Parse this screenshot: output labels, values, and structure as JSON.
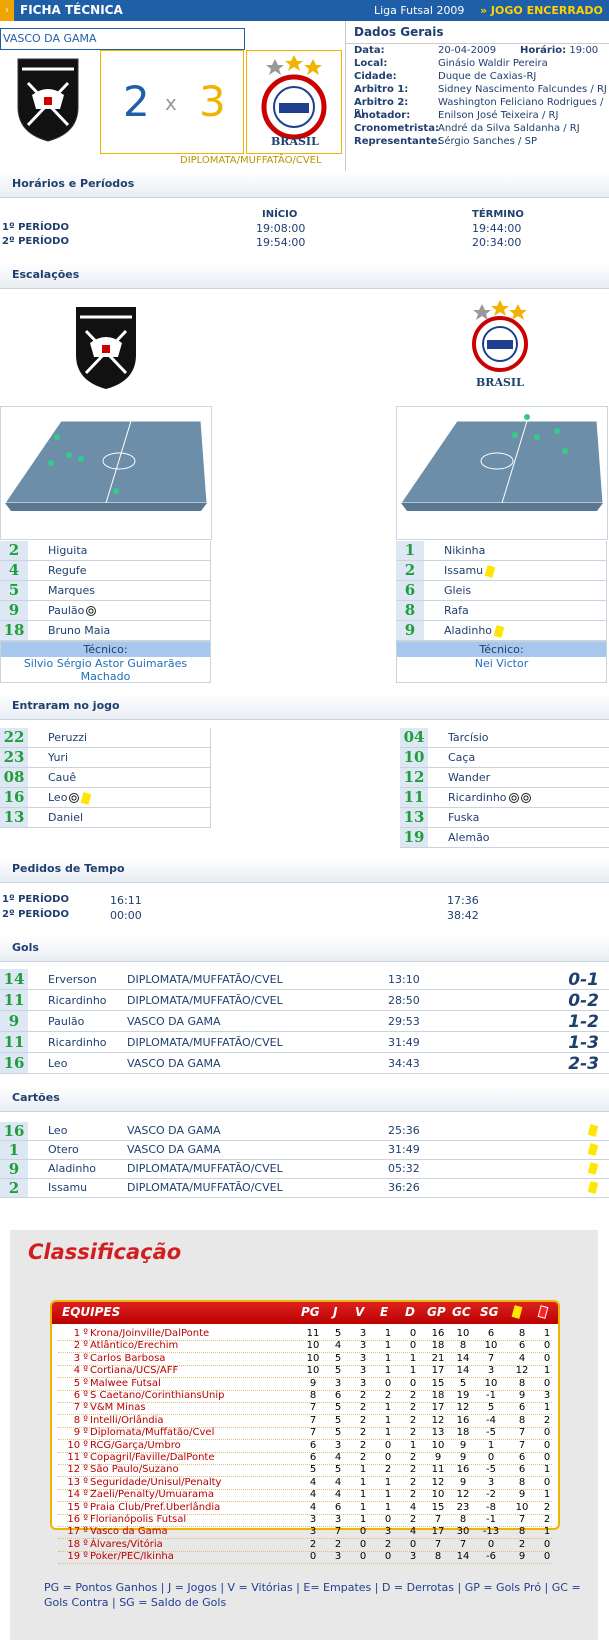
{
  "header": {
    "title": "FICHA TÉCNICA",
    "league": "Liga Futsal 2009",
    "status": "» JOGO ENCERRADO"
  },
  "match": {
    "home_name": "VASCO DA GAMA",
    "away_name": "DIPLOMATA/MUFFATÃO/CVEL",
    "home_score": "2",
    "separator": "x",
    "away_score": "3",
    "away_logo_text": "BRASIL"
  },
  "dados": {
    "title": "Dados Gerais",
    "rows": [
      {
        "label": "Data:",
        "value": "20-04-2009"
      },
      {
        "label": "Local:",
        "value": "Ginásio Waldir Pereira"
      },
      {
        "label": "Cidade:",
        "value": "Duque de Caxias-RJ"
      },
      {
        "label": "Arbitro 1:",
        "value": "Sidney Nascimento Falcundes / RJ"
      },
      {
        "label": "Arbitro 2:",
        "value": "Washington Feliciano Rodrigues / RJ"
      },
      {
        "label": "Anotador:",
        "value": "Enilson José Teixeira / RJ"
      },
      {
        "label": "Cronometrista:",
        "value": "André da Silva Saldanha / RJ"
      },
      {
        "label": "Representante:",
        "value": "Sérgio Sanches / SP"
      }
    ],
    "horario_label": "Horário:",
    "horario_value": "19:00"
  },
  "horarios": {
    "title": "Horários e Períodos",
    "inicio": "INÍCIO",
    "termino": "TÉRMINO",
    "rows": [
      {
        "label": "1º PERÍODO",
        "start": "19:08:00",
        "end": "19:44:00"
      },
      {
        "label": "2º PERÍODO",
        "start": "19:54:00",
        "end": "20:34:00"
      }
    ]
  },
  "escalacoes": {
    "title": "Escalações",
    "home": [
      {
        "num": "2",
        "name": "Higuita"
      },
      {
        "num": "4",
        "name": "Regufe"
      },
      {
        "num": "5",
        "name": "Marques"
      },
      {
        "num": "9",
        "name": "Paulão"
      },
      {
        "num": "18",
        "name": "Bruno Maia"
      }
    ],
    "away": [
      {
        "num": "1",
        "name": "Nikinha"
      },
      {
        "num": "2",
        "name": "Issamu"
      },
      {
        "num": "6",
        "name": "Gleis"
      },
      {
        "num": "8",
        "name": "Rafa"
      },
      {
        "num": "9",
        "name": "Aladinho"
      }
    ],
    "tecnico_label": "Técnico:",
    "home_tecnico": "Silvio Sérgio Astor Guimarães Machado",
    "away_tecnico": "Nei Victor"
  },
  "entraram": {
    "title": "Entraram no jogo",
    "home": [
      {
        "num": "22",
        "name": "Peruzzi"
      },
      {
        "num": "23",
        "name": "Yuri"
      },
      {
        "num": "08",
        "name": "Cauê"
      },
      {
        "num": "16",
        "name": "Leo"
      },
      {
        "num": "13",
        "name": "Daniel"
      }
    ],
    "away": [
      {
        "num": "04",
        "name": "Tarcísio"
      },
      {
        "num": "10",
        "name": "Caça"
      },
      {
        "num": "12",
        "name": "Wander"
      },
      {
        "num": "11",
        "name": "Ricardinho"
      },
      {
        "num": "13",
        "name": "Fuska"
      },
      {
        "num": "19",
        "name": "Alemão"
      }
    ]
  },
  "pedidos": {
    "title": "Pedidos de Tempo",
    "rows": [
      {
        "label": "1º PERÍODO",
        "home": "16:11",
        "away": "17:36"
      },
      {
        "label": "2º PERÍODO",
        "home": "00:00",
        "away": "38:42"
      }
    ]
  },
  "gols": {
    "title": "Gols",
    "rows": [
      {
        "num": "14",
        "player": "Erverson",
        "team": "DIPLOMATA/MUFFATÃO/CVEL",
        "time": "13:10",
        "score": "0-1"
      },
      {
        "num": "11",
        "player": "Ricardinho",
        "team": "DIPLOMATA/MUFFATÃO/CVEL",
        "time": "28:50",
        "score": "0-2"
      },
      {
        "num": "9",
        "player": "Paulão",
        "team": "VASCO DA GAMA",
        "time": "29:53",
        "score": "1-2"
      },
      {
        "num": "11",
        "player": "Ricardinho",
        "team": "DIPLOMATA/MUFFATÃO/CVEL",
        "time": "31:49",
        "score": "1-3"
      },
      {
        "num": "16",
        "player": "Leo",
        "team": "VASCO DA GAMA",
        "time": "34:43",
        "score": "2-3"
      }
    ]
  },
  "cartoes": {
    "title": "Cartões",
    "rows": [
      {
        "num": "16",
        "player": "Leo",
        "team": "VASCO DA GAMA",
        "time": "25:36"
      },
      {
        "num": "1",
        "player": "Otero",
        "team": "VASCO DA GAMA",
        "time": "31:49"
      },
      {
        "num": "9",
        "player": "Aladinho",
        "team": "DIPLOMATA/MUFFATÃO/CVEL",
        "time": "05:32"
      },
      {
        "num": "2",
        "player": "Issamu",
        "team": "DIPLOMATA/MUFFATÃO/CVEL",
        "time": "36:26"
      }
    ]
  },
  "classificacao": {
    "title": "Classificação",
    "headers": [
      "EQUIPES",
      "PG",
      "J",
      "V",
      "E",
      "D",
      "GP",
      "GC",
      "SG"
    ],
    "rows": [
      {
        "pos": "1 º",
        "team": "Krona/Joinville/DalPonte",
        "v": [
          "11",
          "5",
          "3",
          "1",
          "0",
          "16",
          "10",
          "6",
          "8",
          "1"
        ]
      },
      {
        "pos": "2 º",
        "team": "Atlântico/Erechim",
        "v": [
          "10",
          "4",
          "3",
          "1",
          "0",
          "18",
          "8",
          "10",
          "6",
          "0"
        ]
      },
      {
        "pos": "3 º",
        "team": "Carlos Barbosa",
        "v": [
          "10",
          "5",
          "3",
          "1",
          "1",
          "21",
          "14",
          "7",
          "4",
          "0"
        ]
      },
      {
        "pos": "4 º",
        "team": "Cortiana/UCS/AFF",
        "v": [
          "10",
          "5",
          "3",
          "1",
          "1",
          "17",
          "14",
          "3",
          "12",
          "1"
        ]
      },
      {
        "pos": "5 º",
        "team": "Malwee Futsal",
        "v": [
          "9",
          "3",
          "3",
          "0",
          "0",
          "15",
          "5",
          "10",
          "8",
          "0"
        ]
      },
      {
        "pos": "6 º",
        "team": "S Caetano/CorinthiansUnip",
        "v": [
          "8",
          "6",
          "2",
          "2",
          "2",
          "18",
          "19",
          "-1",
          "9",
          "3"
        ]
      },
      {
        "pos": "7 º",
        "team": "V&M Minas",
        "v": [
          "7",
          "5",
          "2",
          "1",
          "2",
          "17",
          "12",
          "5",
          "6",
          "1"
        ]
      },
      {
        "pos": "8 º",
        "team": "Intelli/Orlândia",
        "v": [
          "7",
          "5",
          "2",
          "1",
          "2",
          "12",
          "16",
          "-4",
          "8",
          "2"
        ]
      },
      {
        "pos": "9 º",
        "team": "Diplomata/Muffatão/Cvel",
        "v": [
          "7",
          "5",
          "2",
          "1",
          "2",
          "13",
          "18",
          "-5",
          "7",
          "0"
        ]
      },
      {
        "pos": "10 º",
        "team": "RCG/Garça/Umbro",
        "v": [
          "6",
          "3",
          "2",
          "0",
          "1",
          "10",
          "9",
          "1",
          "7",
          "0"
        ]
      },
      {
        "pos": "11 º",
        "team": "Copagril/Faville/DalPonte",
        "v": [
          "6",
          "4",
          "2",
          "0",
          "2",
          "9",
          "9",
          "0",
          "6",
          "0"
        ]
      },
      {
        "pos": "12 º",
        "team": "São Paulo/Suzano",
        "v": [
          "5",
          "5",
          "1",
          "2",
          "2",
          "11",
          "16",
          "-5",
          "6",
          "1"
        ]
      },
      {
        "pos": "13 º",
        "team": "Seguridade/Unisul/Penalty",
        "v": [
          "4",
          "4",
          "1",
          "1",
          "2",
          "12",
          "9",
          "3",
          "8",
          "0"
        ]
      },
      {
        "pos": "14 º",
        "team": "Zaeli/Penalty/Umuarama",
        "v": [
          "4",
          "4",
          "1",
          "1",
          "2",
          "10",
          "12",
          "-2",
          "9",
          "1"
        ]
      },
      {
        "pos": "15 º",
        "team": "Praia Club/Pref.Uberlândia",
        "v": [
          "4",
          "6",
          "1",
          "1",
          "4",
          "15",
          "23",
          "-8",
          "10",
          "2"
        ]
      },
      {
        "pos": "16 º",
        "team": "Florianópolis Futsal",
        "v": [
          "3",
          "3",
          "1",
          "0",
          "2",
          "7",
          "8",
          "-1",
          "7",
          "2"
        ]
      },
      {
        "pos": "17 º",
        "team": "Vasco da Gama",
        "v": [
          "3",
          "7",
          "0",
          "3",
          "4",
          "17",
          "30",
          "-13",
          "8",
          "1"
        ]
      },
      {
        "pos": "18 º",
        "team": "Álvares/Vitória",
        "v": [
          "2",
          "2",
          "0",
          "2",
          "0",
          "7",
          "7",
          "0",
          "2",
          "0"
        ]
      },
      {
        "pos": "19 º",
        "team": "Poker/PEC/Ikinha",
        "v": [
          "0",
          "3",
          "0",
          "0",
          "3",
          "8",
          "14",
          "-6",
          "9",
          "0"
        ]
      }
    ],
    "legend": "PG = Pontos Ganhos | J = Jogos | V = Vitórias | E= Empates | D = Derrotas | GP = Gols Pró | GC = Gols Contra | SG = Saldo de Gols"
  },
  "colors": {
    "accent": "#1f5fa8",
    "gold": "#f0b400",
    "red": "#d21e1e",
    "number_green": "#1f9e3a"
  }
}
